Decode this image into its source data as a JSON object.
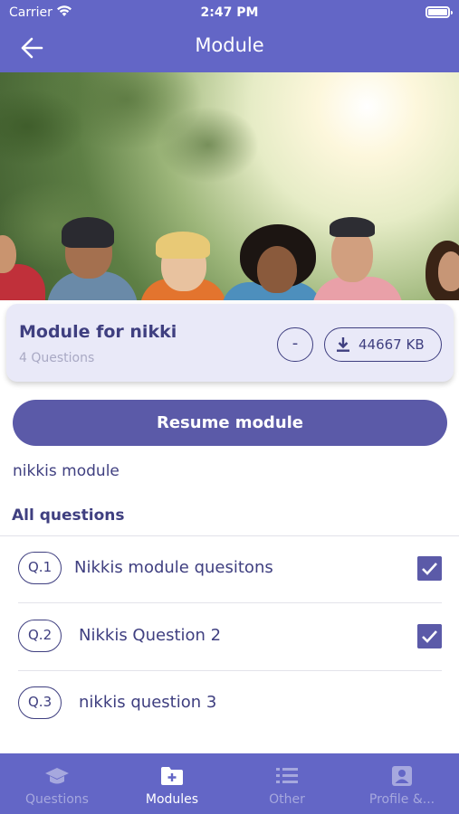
{
  "status_bar": {
    "carrier": "Carrier",
    "time": "2:47 PM"
  },
  "header": {
    "title": "Module"
  },
  "module": {
    "title": "Module for nikki",
    "question_count": "4 Questions",
    "minus_label": "-",
    "size_label": "44667 KB"
  },
  "resume_label": "Resume module",
  "description": "nikkis module",
  "section_title": "All questions",
  "questions": [
    {
      "num": "Q.1",
      "text": "Nikkis module quesitons",
      "checked": true
    },
    {
      "num": "Q.2",
      "text": "Nikkis Question 2",
      "checked": true
    },
    {
      "num": "Q.3",
      "text": "nikkis question 3",
      "checked": false
    }
  ],
  "tabs": [
    {
      "label": "Questions",
      "icon": "graduation-cap-icon",
      "active": false
    },
    {
      "label": "Modules",
      "icon": "folder-plus-icon",
      "active": true
    },
    {
      "label": "Other",
      "icon": "list-icon",
      "active": false
    },
    {
      "label": "Profile &...",
      "icon": "profile-icon",
      "active": false
    }
  ],
  "colors": {
    "primary": "#6366c6",
    "button": "#5b5aa8",
    "text": "#3f3f80",
    "card": "#e9e9f8"
  }
}
